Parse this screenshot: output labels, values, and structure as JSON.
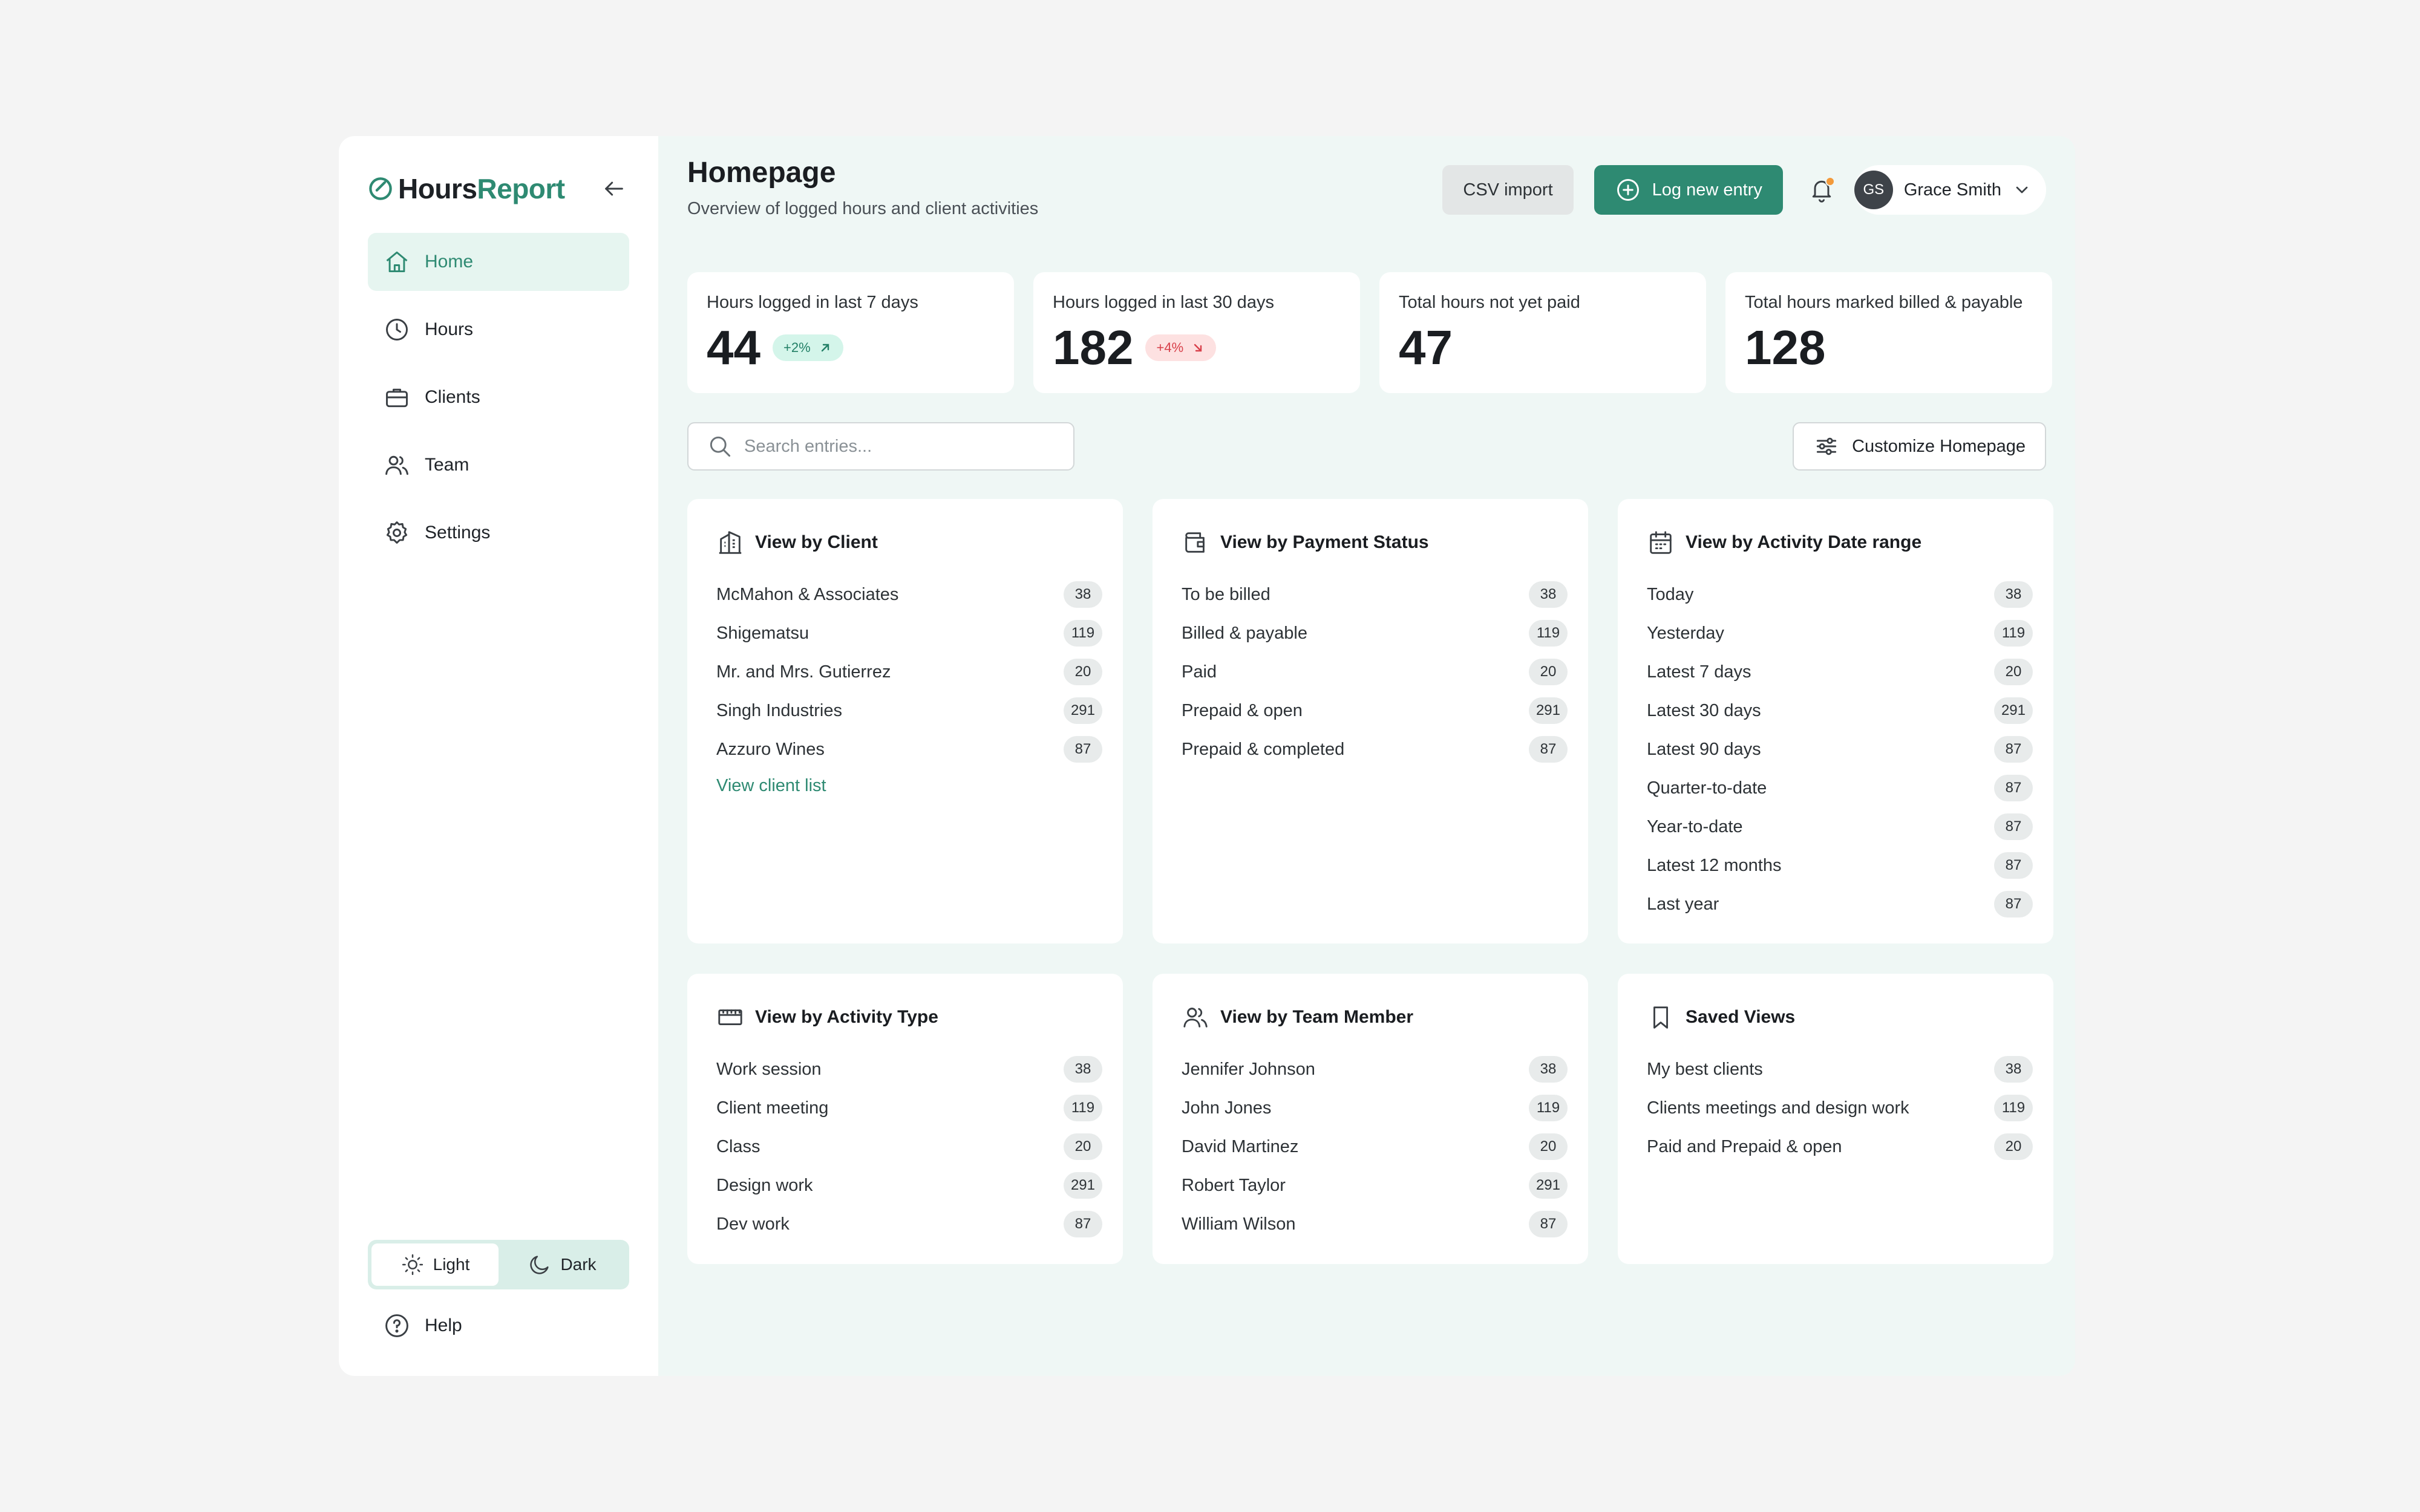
{
  "app": {
    "brand_part1": "Hours",
    "brand_part2": "Report",
    "accent_color": "#2e8a72"
  },
  "sidebar": {
    "items": [
      {
        "label": "Home",
        "icon": "home-icon",
        "active": true
      },
      {
        "label": "Hours",
        "icon": "clock-icon",
        "active": false
      },
      {
        "label": "Clients",
        "icon": "briefcase-icon",
        "active": false
      },
      {
        "label": "Team",
        "icon": "users-icon",
        "active": false
      },
      {
        "label": "Settings",
        "icon": "gear-icon",
        "active": false
      }
    ],
    "theme": {
      "light_label": "Light",
      "dark_label": "Dark",
      "selected": "Light"
    },
    "help_label": "Help"
  },
  "header": {
    "title": "Homepage",
    "subtitle": "Overview of logged hours and client activities",
    "csv_label": "CSV import",
    "log_label": "Log new entry",
    "user": {
      "initials": "GS",
      "name": "Grace Smith"
    }
  },
  "stats": [
    {
      "label": "Hours logged in last 7 days",
      "value": "44",
      "change": "+2%",
      "trend": "up"
    },
    {
      "label": "Hours logged in last 30 days",
      "value": "182",
      "change": "+4%",
      "trend": "down"
    },
    {
      "label": "Total hours not yet paid",
      "value": "47"
    },
    {
      "label": "Total hours marked billed & payable",
      "value": "128"
    }
  ],
  "search": {
    "placeholder": "Search entries..."
  },
  "customize_label": "Customize Homepage",
  "cards": {
    "client": {
      "title": "View by Client",
      "rows": [
        {
          "label": "McMahon & Associates",
          "count": "38"
        },
        {
          "label": "Shigematsu",
          "count": "119"
        },
        {
          "label": "Mr. and Mrs. Gutierrez",
          "count": "20"
        },
        {
          "label": "Singh Industries",
          "count": "291"
        },
        {
          "label": "Azzuro Wines",
          "count": "87"
        }
      ],
      "link": "View client list"
    },
    "payment": {
      "title": "View by Payment Status",
      "rows": [
        {
          "label": "To be billed",
          "count": "38"
        },
        {
          "label": "Billed & payable",
          "count": "119"
        },
        {
          "label": "Paid",
          "count": "20"
        },
        {
          "label": "Prepaid & open",
          "count": "291"
        },
        {
          "label": "Prepaid & completed",
          "count": "87"
        }
      ]
    },
    "date": {
      "title": "View by Activity Date range",
      "rows": [
        {
          "label": "Today",
          "count": "38"
        },
        {
          "label": "Yesterday",
          "count": "119"
        },
        {
          "label": "Latest 7 days",
          "count": "20"
        },
        {
          "label": "Latest 30 days",
          "count": "291"
        },
        {
          "label": "Latest 90 days",
          "count": "87"
        },
        {
          "label": "Quarter-to-date",
          "count": "87"
        },
        {
          "label": "Year-to-date",
          "count": "87"
        },
        {
          "label": "Latest 12 months",
          "count": "87"
        },
        {
          "label": "Last year",
          "count": "87"
        }
      ]
    },
    "activity": {
      "title": "View by Activity Type",
      "rows": [
        {
          "label": "Work session",
          "count": "38"
        },
        {
          "label": "Client meeting",
          "count": "119"
        },
        {
          "label": "Class",
          "count": "20"
        },
        {
          "label": "Design work",
          "count": "291"
        },
        {
          "label": "Dev work",
          "count": "87"
        }
      ]
    },
    "team": {
      "title": "View by Team Member",
      "rows": [
        {
          "label": "Jennifer Johnson",
          "count": "38"
        },
        {
          "label": "John Jones",
          "count": "119"
        },
        {
          "label": "David Martinez",
          "count": "20"
        },
        {
          "label": "Robert Taylor",
          "count": "291"
        },
        {
          "label": "William Wilson",
          "count": "87"
        }
      ]
    },
    "saved": {
      "title": "Saved Views",
      "rows": [
        {
          "label": "My best clients",
          "count": "38"
        },
        {
          "label": "Clients meetings and design work",
          "count": "119"
        },
        {
          "label": "Paid and Prepaid & open",
          "count": "20"
        }
      ]
    }
  }
}
